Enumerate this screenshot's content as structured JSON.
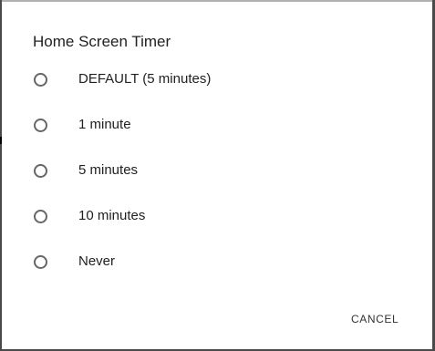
{
  "dialog": {
    "title": "Home Screen Timer",
    "options": [
      {
        "label": "DEFAULT (5 minutes)",
        "selected": false
      },
      {
        "label": "1 minute",
        "selected": false
      },
      {
        "label": "5 minutes",
        "selected": false
      },
      {
        "label": "10 minutes",
        "selected": false
      },
      {
        "label": "Never",
        "selected": false
      }
    ],
    "cancel_label": "CANCEL"
  }
}
